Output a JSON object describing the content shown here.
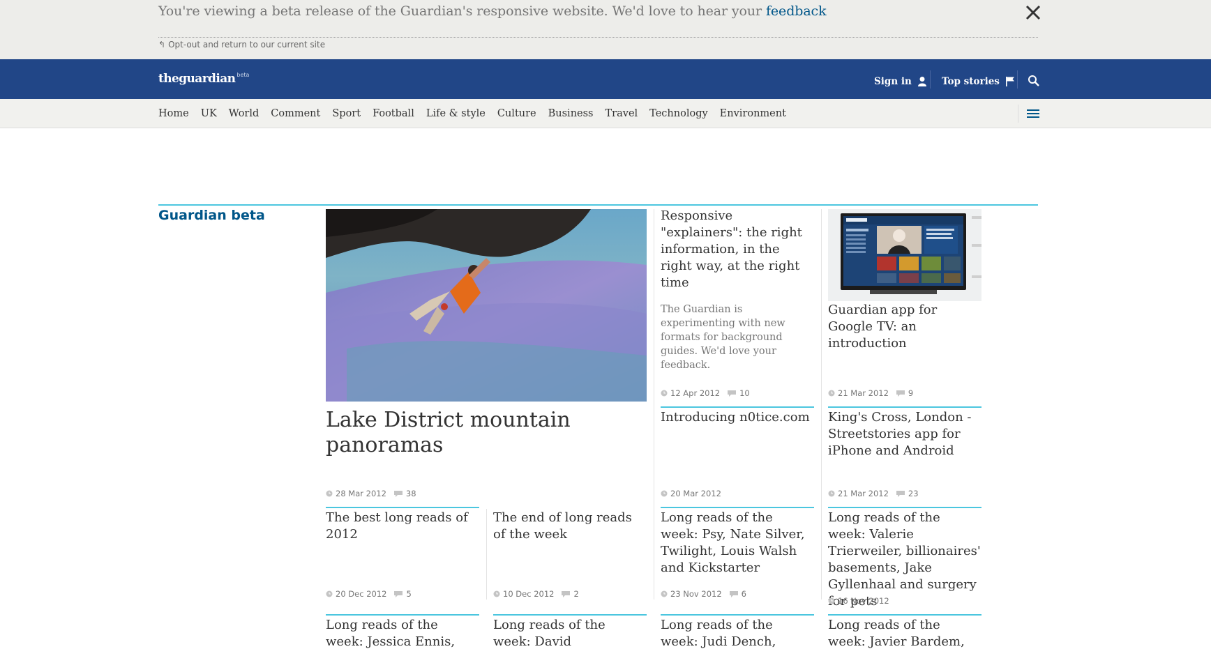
{
  "beta_banner": {
    "message": "You're viewing a beta release of the Guardian's responsive website. We'd love to hear your",
    "feedback_link": "feedback",
    "optout_arrow": "↰",
    "optout_label": "Opt-out and return to our current site",
    "close_icon": "close-icon"
  },
  "masthead": {
    "logo_the": "the",
    "logo_guardian": "guardian",
    "logo_beta": "beta",
    "signin_label": "Sign in",
    "topstories_label": "Top stories",
    "background": "#214687"
  },
  "nav": {
    "items": [
      "Home",
      "UK",
      "World",
      "Comment",
      "Sport",
      "Football",
      "Life & style",
      "Culture",
      "Business",
      "Travel",
      "Technology",
      "Environment"
    ]
  },
  "section": {
    "title": "Guardian beta",
    "accent": "#4bc6df"
  },
  "cards": [
    {
      "title": "Lake District mountain panoramas",
      "date": "28 Mar 2012",
      "comments": "38",
      "image": "rock-climber-photo"
    },
    {
      "title": "Responsive \"explainers\": the right information, in the right way, at the right time",
      "standfirst": "The Guardian is experimenting with new formats for background guides. We'd love your feedback.",
      "date": "12 Apr 2012",
      "comments": "10"
    },
    {
      "title": "Guardian app for Google TV: an introduction",
      "date": "21 Mar 2012",
      "comments": "9",
      "image": "google-tv-photo"
    },
    {
      "title": "Introducing n0tice.com",
      "date": "20 Mar 2012"
    },
    {
      "title": "King's Cross, London - Streetstories app for iPhone and Android",
      "date": "21 Mar 2012",
      "comments": "23"
    },
    {
      "title": "The best long reads of 2012",
      "date": "20 Dec 2012",
      "comments": "5"
    },
    {
      "title": "The end of long reads of the week",
      "date": "10 Dec 2012",
      "comments": "2"
    },
    {
      "title": "Long reads of the week: Psy, Nate Silver, Twilight, Louis Walsh and Kickstarter",
      "date": "23 Nov 2012",
      "comments": "6"
    },
    {
      "title": "Long reads of the week: Valerie Trierweiler, billionaires' basements, Jake Gyllenhaal and surgery for pets",
      "date": "16 Nov 2012"
    },
    {
      "title": "Long reads of the week: Jessica Ennis, Bradley"
    },
    {
      "title": "Long reads of the week: David Attenborough,"
    },
    {
      "title": "Long reads of the week: Judi Dench, Orlando"
    },
    {
      "title": "Long reads of the week: Javier Bardem, Tim"
    }
  ]
}
